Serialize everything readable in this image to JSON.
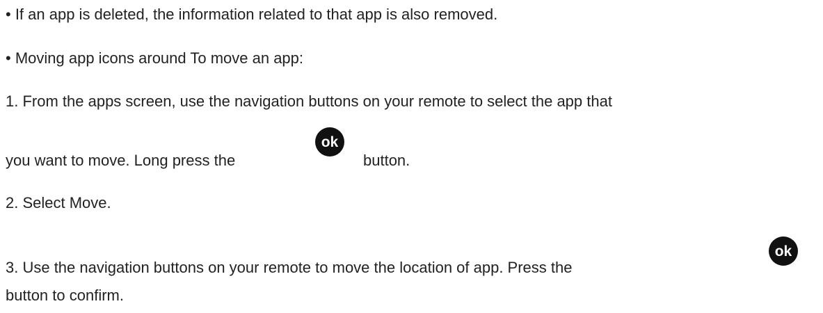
{
  "paragraphs": {
    "bullet_deleted": "• If an app is deleted, the information related to that app is also removed.",
    "bullet_moving": "• Moving app icons around To move an app:",
    "step1_line1": "1. From the apps screen, use the navigation buttons on your remote to select the app that",
    "step1_line2_a": "you want to move. Long press the",
    "step1_line2_b": "button.",
    "step2": "2. Select Move.",
    "step3_line1": "3. Use the navigation buttons on your remote to move the location of app. Press the",
    "step3_line2": "button to confirm."
  },
  "icons": {
    "ok_button_label": "ok",
    "ok_button_color": "#111111"
  }
}
